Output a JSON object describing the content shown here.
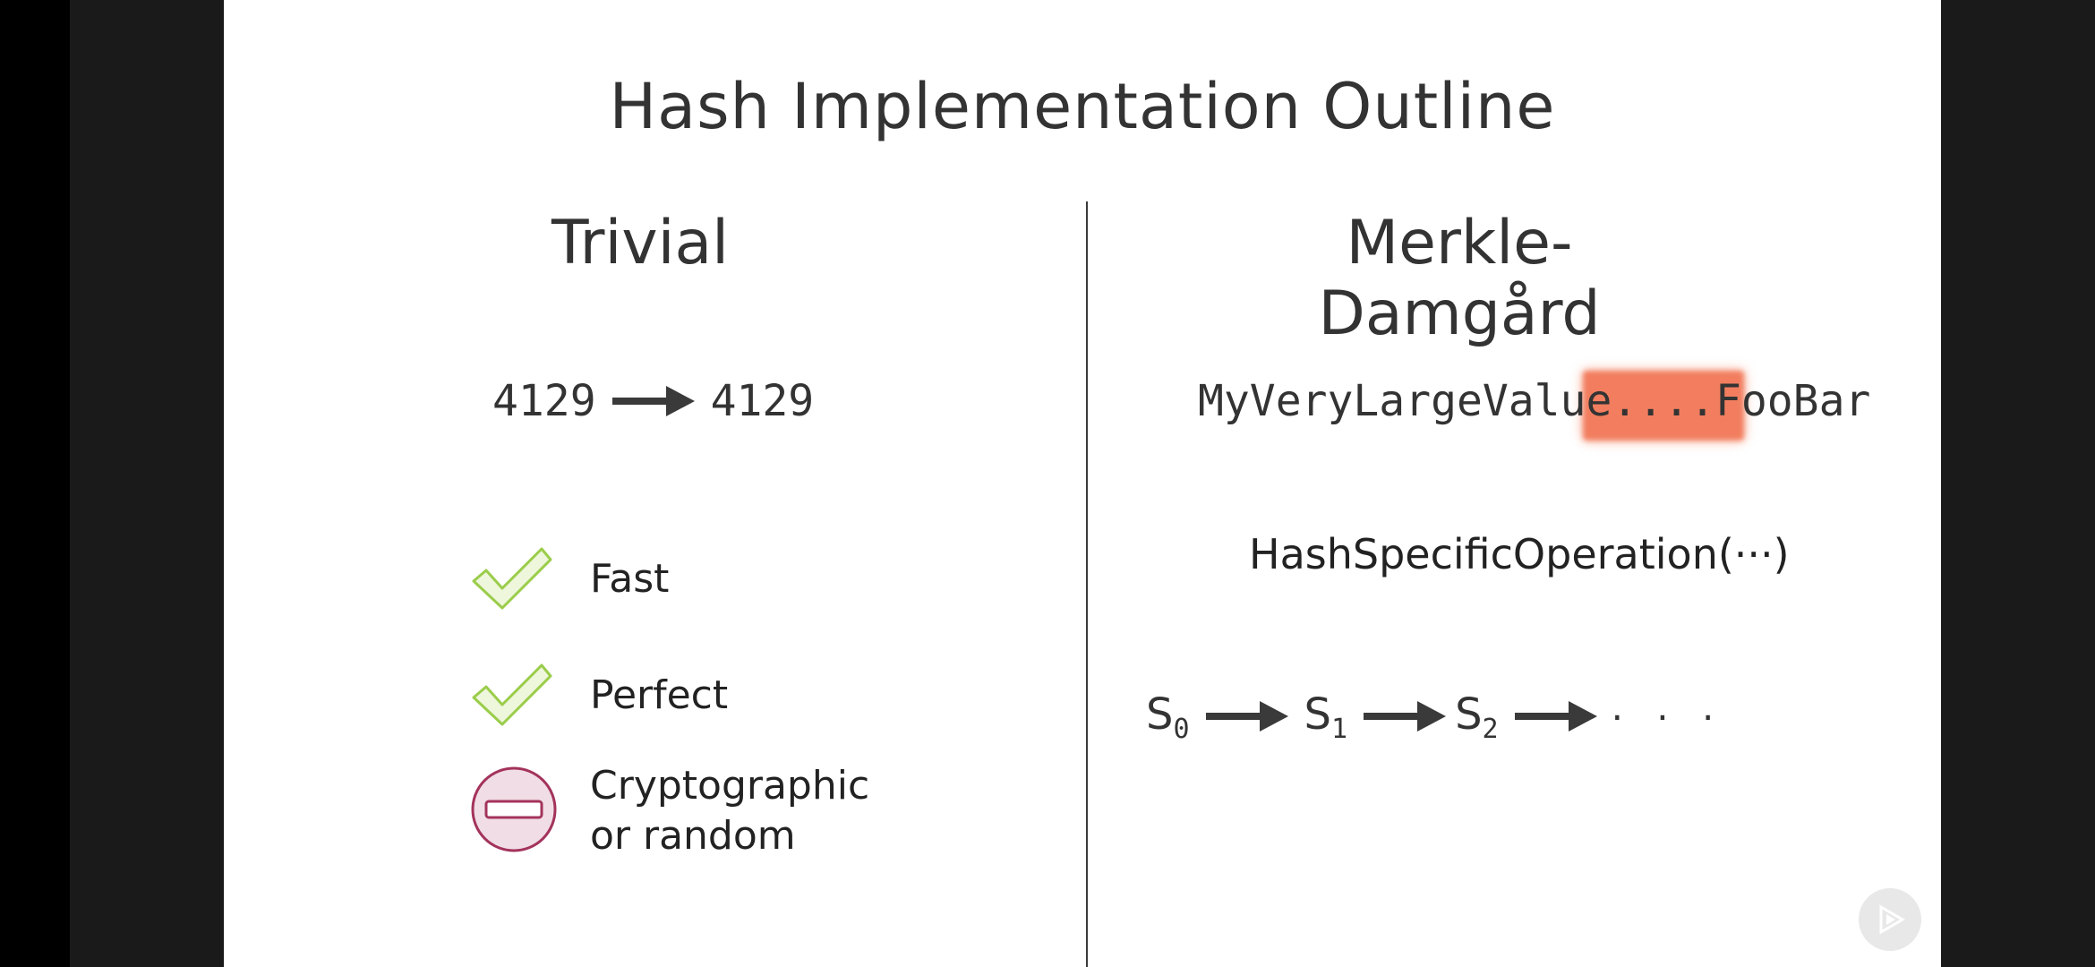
{
  "slide": {
    "title": "Hash Implementation Outline",
    "left_heading": "Trivial",
    "right_heading": "Merkle-Damgård",
    "trivial_input": "4129",
    "trivial_output": "4129",
    "features": [
      {
        "label": "Fast",
        "status": "check",
        "color": "#9acd4a"
      },
      {
        "label": "Perfect",
        "status": "check",
        "color": "#9acd4a"
      },
      {
        "label_line1": "Cryptographic",
        "label_line2": "or random",
        "status": "minus",
        "color": "#a3335c"
      }
    ],
    "md_string_prefix": "MyVeryLargeV",
    "md_string_highlight": "alue...",
    "md_string_suffix": ".FooBar",
    "highlight_color": "#f27e5f",
    "hash_operation": "HashSpecificOperation(···)",
    "chain": {
      "s0": "S",
      "s0_sub": "0",
      "s1": "S",
      "s1_sub": "1",
      "s2": "S",
      "s2_sub": "2",
      "ellipsis": "· · ·"
    }
  },
  "controls": {
    "play_icon": "play-icon"
  }
}
